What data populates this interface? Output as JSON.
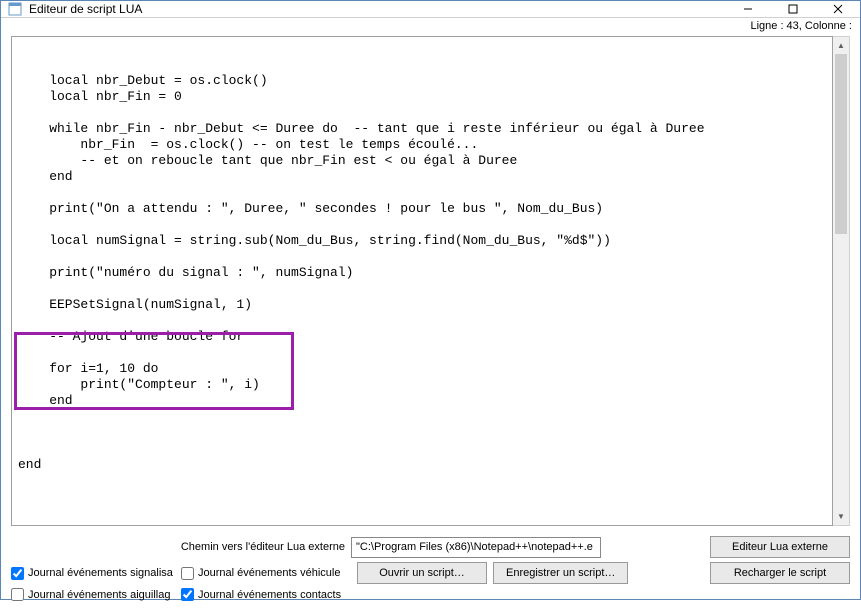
{
  "window": {
    "title": "Editeur de script LUA"
  },
  "status": {
    "line_col": "Ligne : 43, Colonne :"
  },
  "code": {
    "l0": "",
    "l1": "    local nbr_Debut = os.clock()",
    "l2": "    local nbr_Fin = 0",
    "l3": "",
    "l4": "    while nbr_Fin - nbr_Debut <= Duree do  -- tant que i reste inférieur ou égal à Duree",
    "l5": "        nbr_Fin  = os.clock() -- on test le temps écoulé...",
    "l6": "        -- et on reboucle tant que nbr_Fin est < ou égal à Duree",
    "l7": "    end",
    "l8": "",
    "l9": "    print(\"On a attendu : \", Duree, \" secondes ! pour le bus \", Nom_du_Bus)",
    "l10": "",
    "l11": "    local numSignal = string.sub(Nom_du_Bus, string.find(Nom_du_Bus, \"%d$\"))",
    "l12": "",
    "l13": "    print(\"numéro du signal : \", numSignal)",
    "l14": "",
    "l15": "    EEPSetSignal(numSignal, 1)",
    "l16": "",
    "l17": "    -- Ajout d'une boucle for",
    "l18": "",
    "l19": "    for i=1, 10 do",
    "l20": "        print(\"Compteur : \", i)",
    "l21": "    end",
    "l22": "",
    "l23": "",
    "l24": "",
    "l25": "end",
    "l26": ""
  },
  "bottom": {
    "path_label": "Chemin vers l'éditeur Lua externe",
    "path_value": "\"C:\\Program Files (x86)\\Notepad++\\notepad++.e",
    "btn_external": "Editeur Lua externe",
    "btn_open": "Ouvrir un script…",
    "btn_save": "Enregistrer un script…",
    "btn_reload": "Recharger le script",
    "chk_signal": "Journal événements signalisa",
    "chk_vehicle": "Journal événements véhicule",
    "chk_switch": "Journal événements aiguillag",
    "chk_contacts": "Journal événements contacts"
  },
  "checks": {
    "signal": true,
    "vehicle": false,
    "switch": false,
    "contacts": true
  }
}
